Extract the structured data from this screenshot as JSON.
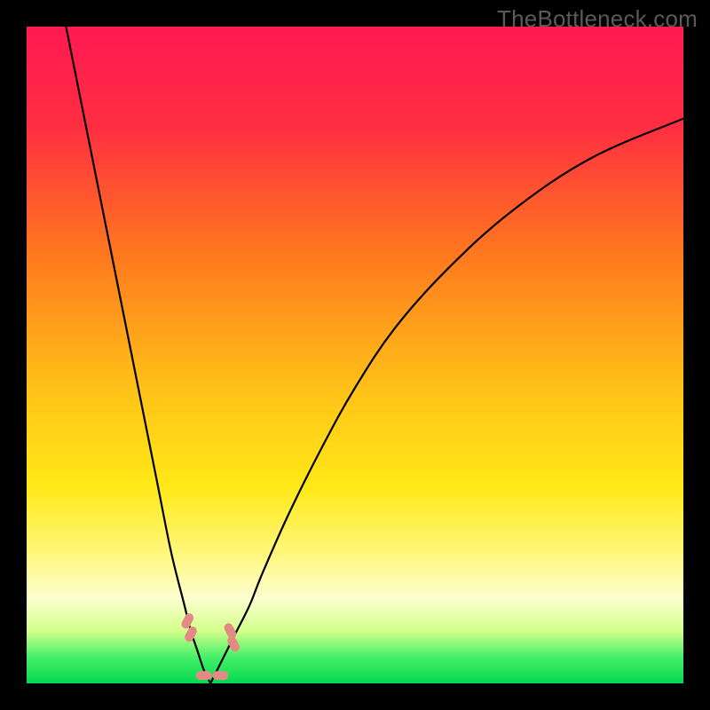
{
  "watermark": "TheBottleneck.com",
  "chart_data": {
    "type": "line",
    "title": "",
    "xlabel": "",
    "ylabel": "",
    "xlim": [
      0,
      100
    ],
    "ylim": [
      0,
      100
    ],
    "gradient_stops": [
      {
        "offset": 0,
        "color": "#ff1a53"
      },
      {
        "offset": 15,
        "color": "#ff2e42"
      },
      {
        "offset": 35,
        "color": "#ff7a1e"
      },
      {
        "offset": 55,
        "color": "#ffc218"
      },
      {
        "offset": 70,
        "color": "#ffe918"
      },
      {
        "offset": 80,
        "color": "#fff77a"
      },
      {
        "offset": 87,
        "color": "#fdffd0"
      },
      {
        "offset": 92,
        "color": "#d4ff8c"
      },
      {
        "offset": 96,
        "color": "#46f06a"
      },
      {
        "offset": 100,
        "color": "#06d94f"
      }
    ],
    "series": [
      {
        "name": "left-curve",
        "x": [
          6,
          8,
          10,
          12,
          14,
          16,
          18,
          20,
          22,
          24,
          25,
          26,
          27,
          28
        ],
        "y": [
          100,
          90,
          80,
          70,
          60,
          50,
          40,
          30,
          20,
          12,
          8,
          5,
          2,
          0
        ]
      },
      {
        "name": "right-curve",
        "x": [
          28,
          29,
          30,
          31,
          32,
          34,
          36,
          40,
          45,
          50,
          56,
          64,
          74,
          86,
          100
        ],
        "y": [
          0,
          2,
          4,
          6,
          8,
          12,
          17,
          26,
          36,
          45,
          54,
          63,
          72,
          80,
          86
        ]
      }
    ],
    "markers": [
      {
        "x": 24.5,
        "y": 9.5
      },
      {
        "x": 25.0,
        "y": 7.5
      },
      {
        "x": 31.0,
        "y": 8.0
      },
      {
        "x": 31.5,
        "y": 6.0
      },
      {
        "x": 27.0,
        "y": 1.2
      },
      {
        "x": 29.5,
        "y": 1.2
      }
    ],
    "marker_color": "#e38a85"
  }
}
